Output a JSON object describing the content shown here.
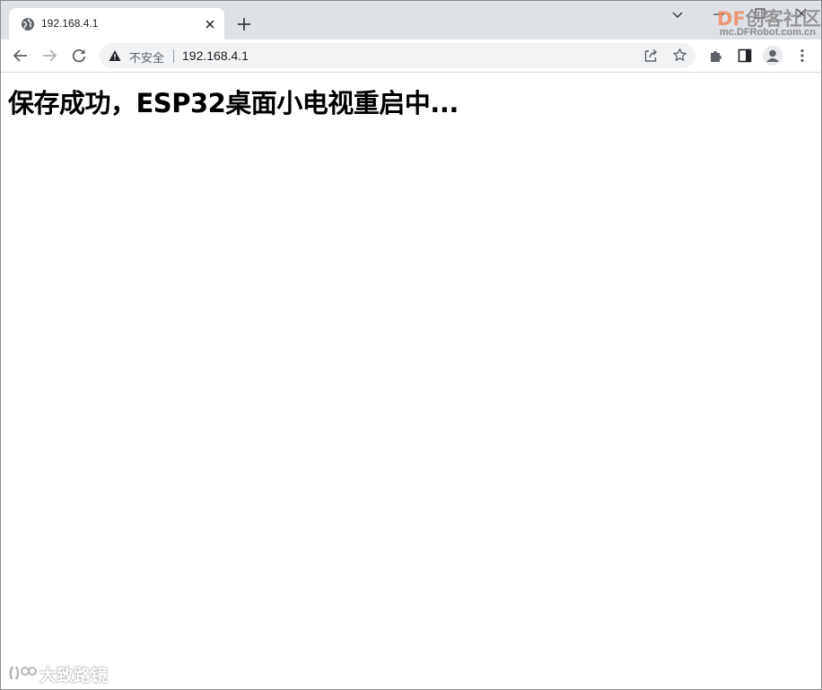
{
  "tab": {
    "title": "192.168.4.1"
  },
  "omnibox": {
    "security_label": "不安全",
    "url": "192.168.4.1"
  },
  "page": {
    "heading": "保存成功，ESP32桌面小电视重启中..."
  },
  "watermark_top": {
    "brand_df": "DF",
    "brand_cn": "创客社区",
    "url": "mc.DFRobot.com.cn"
  },
  "watermark_bottom": {
    "text": "大致路镜"
  },
  "icons": {
    "globe": "globe-icon",
    "close": "close-icon",
    "new_tab": "plus-icon",
    "back": "back-arrow-icon",
    "forward": "forward-arrow-icon",
    "reload": "reload-icon",
    "warning": "warning-icon",
    "share": "share-icon",
    "bookmark": "star-icon",
    "extensions": "puzzle-icon",
    "side_panel": "side-panel-icon",
    "profile": "profile-icon",
    "menu": "kebab-menu-icon"
  },
  "colors": {
    "tabstrip": "#dee1e6",
    "omnibox_bg": "#f1f3f4",
    "icon": "#5f6368"
  }
}
